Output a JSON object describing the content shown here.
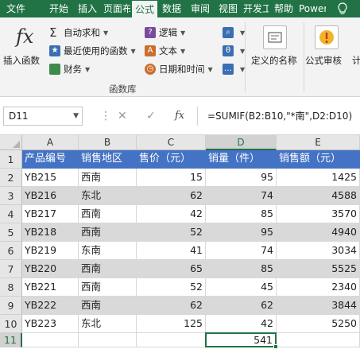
{
  "ribbon_tabs": [
    "文件",
    "开始",
    "插入",
    "页面布局",
    "公式",
    "数据",
    "审阅",
    "视图",
    "开发工具",
    "帮助",
    "Power",
    "?"
  ],
  "active_tab": "公式",
  "function_library": {
    "insert_function": "插入函数",
    "autosum": "自动求和",
    "recently_used": "最近使用的函数",
    "financial": "财务",
    "logical": "逻辑",
    "text": "文本",
    "date_time": "日期和时间",
    "group_label": "函数库"
  },
  "defined_names": "定义的名称",
  "formula_auditing": "公式审核",
  "calc_partial": "计",
  "name_box": "D11",
  "formula_buttons": {
    "cancel": "✕",
    "enter": "✓",
    "fx": "fx"
  },
  "formula": "=SUMIF(B2:B10,\"*南\",D2:D10)",
  "columns": [
    "A",
    "B",
    "C",
    "D",
    "E"
  ],
  "selected_column": "D",
  "row_numbers": [
    "1",
    "2",
    "3",
    "4",
    "5",
    "6",
    "7",
    "8",
    "9",
    "10",
    "11"
  ],
  "selected_row": "11",
  "headers": [
    "产品编号",
    "销售地区",
    "售价（元）",
    "销量（件）",
    "销售额（元）"
  ],
  "rows": [
    [
      "YB215",
      "西南",
      "15",
      "95",
      "1425"
    ],
    [
      "YB216",
      "东北",
      "62",
      "74",
      "4588"
    ],
    [
      "YB217",
      "西南",
      "42",
      "85",
      "3570"
    ],
    [
      "YB218",
      "西南",
      "52",
      "95",
      "4940"
    ],
    [
      "YB219",
      "东南",
      "41",
      "74",
      "3034"
    ],
    [
      "YB220",
      "西南",
      "65",
      "85",
      "5525"
    ],
    [
      "YB221",
      "西南",
      "52",
      "45",
      "2340"
    ],
    [
      "YB222",
      "西南",
      "62",
      "62",
      "3844"
    ],
    [
      "YB223",
      "东北",
      "125",
      "42",
      "5250"
    ]
  ],
  "result_row": [
    "",
    "",
    "",
    "541",
    ""
  ],
  "colors": {
    "ribbon_green": "#217346",
    "header_blue": "#4472c4",
    "band_gray": "#d9d9d9"
  },
  "icons": [
    "fx-icon",
    "sigma-icon",
    "star-icon",
    "book-icon",
    "logic-book-icon",
    "text-A-icon",
    "clock-icon",
    "name-tag-icon",
    "audit-icon"
  ]
}
